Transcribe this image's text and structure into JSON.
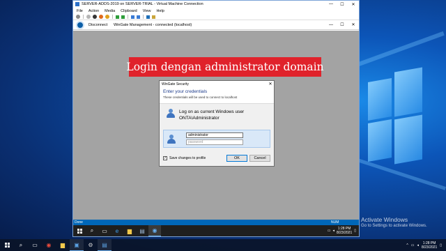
{
  "vm_window": {
    "title": "SERVER-ADDS-2019 on SERVER-TRIAL - Virtual Machine Connection",
    "controls": {
      "minimize": "—",
      "maximize": "☐",
      "close": "✕"
    },
    "menu": [
      "File",
      "Action",
      "Media",
      "Clipboard",
      "View",
      "Help"
    ],
    "toolbar_icons": [
      "ctrl-alt-del-icon",
      "start-icon",
      "turn-off-icon",
      "shutdown-icon",
      "save-icon",
      "pause-icon",
      "play-icon",
      "checkpoint-icon",
      "revert-icon",
      "enhanced-session-icon",
      "share-icon"
    ]
  },
  "wingate": {
    "disconnect_label": "Disconnect",
    "title": "WinGate Management - connected (localhost)",
    "controls": {
      "minimize": "—",
      "maximize": "☐",
      "close": "✕"
    }
  },
  "banner": {
    "text": "Login dengan administrator domain",
    "color": "#e0222b"
  },
  "dialog": {
    "title": "WinGate Security",
    "close": "✕",
    "heading": "Enter your credentials",
    "subheading": "These credentials will be used to connect to localhost",
    "option_current_user": {
      "line1": "Log on as current Windows user",
      "line2": "ONTA\\Administrator"
    },
    "username_value": "administrator",
    "password_placeholder": "password",
    "save_checkbox": {
      "label": "Save changes to profile",
      "checked": true,
      "mark": "✓"
    },
    "ok_label": "OK",
    "cancel_label": "Cancel"
  },
  "vm_status": {
    "left": "Done",
    "right": "NUM"
  },
  "guest_taskbar": {
    "icons": [
      "start-icon",
      "search-icon",
      "task-view-icon",
      "ie-icon",
      "file-explorer-icon",
      "server-manager-icon",
      "wingate-icon"
    ],
    "clock_time": "1:28 PM",
    "clock_date": "8/23/2021"
  },
  "host": {
    "activate_line1": "Activate Windows",
    "activate_line2": "Go to Settings to activate Windows.",
    "taskbar_icons": [
      "start-icon",
      "search-icon",
      "task-view-icon",
      "chrome-icon",
      "file-explorer-icon",
      "hyperv-manager-icon",
      "settings-icon",
      "vm-connection-icon"
    ],
    "clock_time": "1:28 PM",
    "clock_date": "8/23/2021"
  }
}
